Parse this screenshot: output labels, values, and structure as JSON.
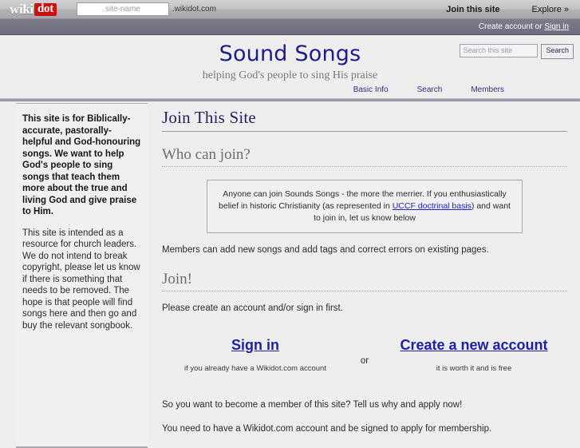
{
  "wikidot_bar": {
    "logo_wiki": "wiki",
    "logo_dot": "dot",
    "site_name_placeholder": "site-name",
    "domain_suffix": ".wikidot.com",
    "join_this_site": "Join this site",
    "explore": "Explore »"
  },
  "account_bar": {
    "create_account_text": "Create account or",
    "sign_in_link": "Sign in"
  },
  "header": {
    "site_title": "Sound Songs",
    "site_subtitle": "helping God's people to sing His praise",
    "search_placeholder": "Search this site",
    "search_button": "Search",
    "nav": [
      {
        "label": "Basic Info"
      },
      {
        "label": "Search"
      },
      {
        "label": "Members"
      }
    ]
  },
  "sidebar": {
    "lead_paragraph": "This site is for Biblically-accurate, pastorally-helpful and God-honouring songs. We want to help God's people to sing songs that teach them more about the true and living God and give praise to Him.",
    "second_paragraph": "This site is intended as a resource for church leaders. We do not intend to break copyright, please let us know if there is something that needs to be removed. The hope is that people will find songs here and then go and buy the relevant songbook."
  },
  "content": {
    "page_title": "Join This Site",
    "who_can_join_heading": "Who can join?",
    "info_box": {
      "text_before_link": "Anyone can join Sounds Songs - the more the merrier. If you enthusiastically belief in historic Christianity (as represented in ",
      "link_label": "UCCF doctrinal basis",
      "text_after_link": ") and want to join in, let us know below"
    },
    "members_note": "Members can add new songs and add tags and correct errors on existing pages.",
    "join_heading": "Join!",
    "join_instruction": "Please create an account and/or sign in first.",
    "sign_in_link": "Sign in",
    "sign_in_caption": "if you already have a Wikidot.com account",
    "or_label": "or",
    "create_account_link": "Create a new account",
    "create_account_caption": "it is worth it and is free",
    "apply_prompt": "So you want to become a member of this site? Tell us why and apply now!",
    "account_requirement": "You need to have a Wikidot.com account and be signed to apply for membership."
  },
  "colors": {
    "title_blue": "#1d1d8c",
    "heading_navy": "#22225e",
    "link_blue": "#1d1dab",
    "logo_red": "#cc1111",
    "page_background": "#eeeeee"
  }
}
